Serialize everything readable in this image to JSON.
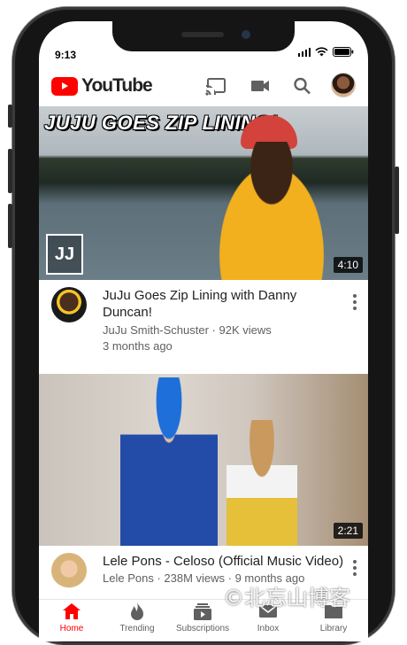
{
  "status_bar": {
    "time": "9:13"
  },
  "app": {
    "logo_text": "YouTube",
    "brand_color": "#ff0000"
  },
  "toolbar_icons": [
    "cast-icon",
    "camera-icon",
    "search-icon",
    "avatar"
  ],
  "videos": [
    {
      "overlay_title": "JUJU GOES ZIP LINING!",
      "duration": "4:10",
      "title": "JuJu Goes Zip Lining with Danny Duncan!",
      "meta_line1": "JuJu Smith-Schuster · 92K views",
      "meta_line2": "3 months ago"
    },
    {
      "duration": "2:21",
      "title": "Lele Pons - Celoso (Official Music Video)",
      "meta_line1": "Lele Pons · 238M views · 9 months ago"
    }
  ],
  "tabs": [
    {
      "label": "Home",
      "icon": "home-icon",
      "active": true
    },
    {
      "label": "Trending",
      "icon": "flame-icon",
      "active": false
    },
    {
      "label": "Subscriptions",
      "icon": "subscriptions-icon",
      "active": false
    },
    {
      "label": "Inbox",
      "icon": "mail-icon",
      "active": false
    },
    {
      "label": "Library",
      "icon": "folder-icon",
      "active": false
    }
  ],
  "watermark": "©北忘山博客"
}
